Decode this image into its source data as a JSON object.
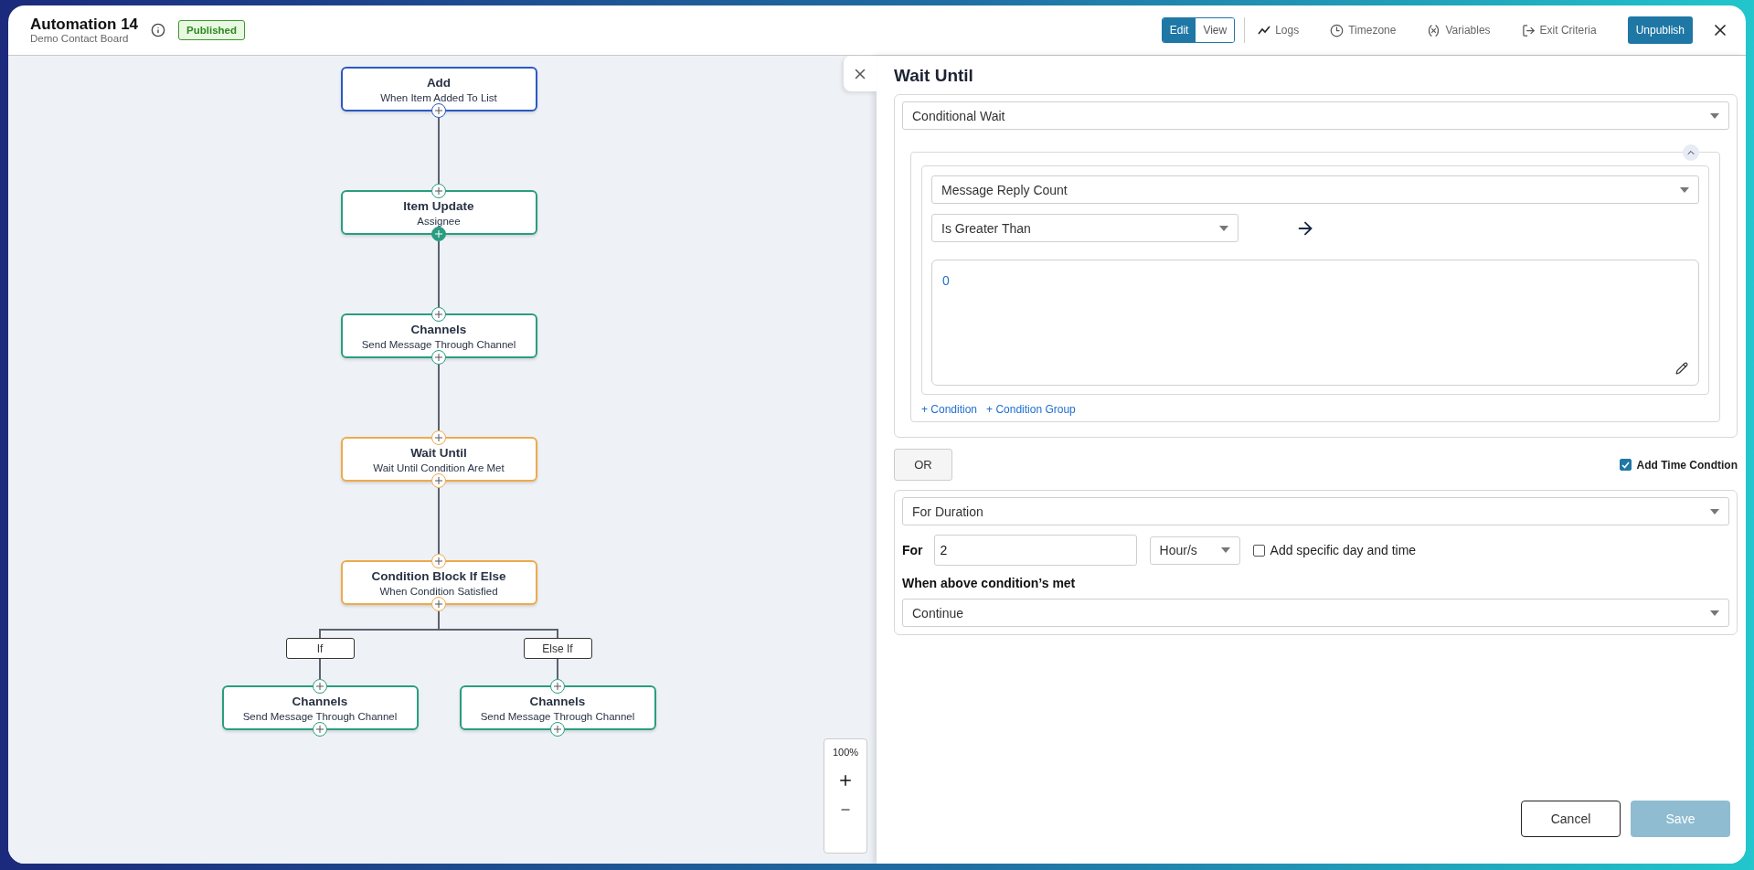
{
  "header": {
    "title": "Automation 14",
    "subtitle": "Demo Contact Board",
    "status": "Published",
    "mode_toggle": [
      {
        "label": "Edit",
        "selected": true
      },
      {
        "label": "View",
        "selected": false
      }
    ],
    "toolbar": [
      {
        "label": "Logs",
        "kind": "logs"
      },
      {
        "label": "Timezone",
        "kind": "timezone"
      },
      {
        "label": "Variables",
        "kind": "variables"
      },
      {
        "label": "Exit Criteria",
        "kind": "exit"
      }
    ],
    "primary_button": "Unpublish"
  },
  "flow": {
    "nodes": [
      {
        "title": "Add",
        "subtitle": "When Item Added To List",
        "kind": "trigger",
        "out_active": false
      },
      {
        "title": "Item Update",
        "subtitle": "Assignee",
        "kind": "action",
        "out_active": true
      },
      {
        "title": "Channels",
        "subtitle": "Send Message Through Channel",
        "kind": "action",
        "out_active": false
      },
      {
        "title": "Wait Until",
        "subtitle": "Wait Until Condition Are Met",
        "kind": "logic",
        "out_active": false
      },
      {
        "title": "Condition Block If Else",
        "subtitle": "When Condition Satisfied",
        "kind": "logic",
        "out_active": false
      }
    ],
    "branches": [
      {
        "label": "If",
        "node": {
          "title": "Channels",
          "subtitle": "Send Message Through Channel",
          "kind": "action",
          "out_active": false
        }
      },
      {
        "label": "Else If",
        "node": {
          "title": "Channels",
          "subtitle": "Send Message Through Channel",
          "kind": "action",
          "out_active": false
        }
      }
    ],
    "zoom": "100%"
  },
  "panel": {
    "title": "Wait Until",
    "wait_type": "Conditional Wait",
    "condition_group": {
      "expanded": true,
      "conditions": [
        {
          "field": "Message Reply Count",
          "operator": "Is Greater Than",
          "value": "0"
        }
      ],
      "add_links": [
        "+ Condition",
        "+ Condition Group"
      ]
    },
    "or_button": "OR",
    "time_condition": {
      "label": "Add Time Condtion",
      "checked": true
    },
    "duration": {
      "type": "For Duration",
      "for_label": "For",
      "amount": "2",
      "unit": "Hour/s",
      "specific_day": {
        "label": "Add specific day and time",
        "checked": false
      },
      "after_label": "When above condition’s met",
      "after_action": "Continue"
    },
    "buttons": {
      "cancel": "Cancel",
      "save": "Save",
      "save_disabled": true
    }
  }
}
